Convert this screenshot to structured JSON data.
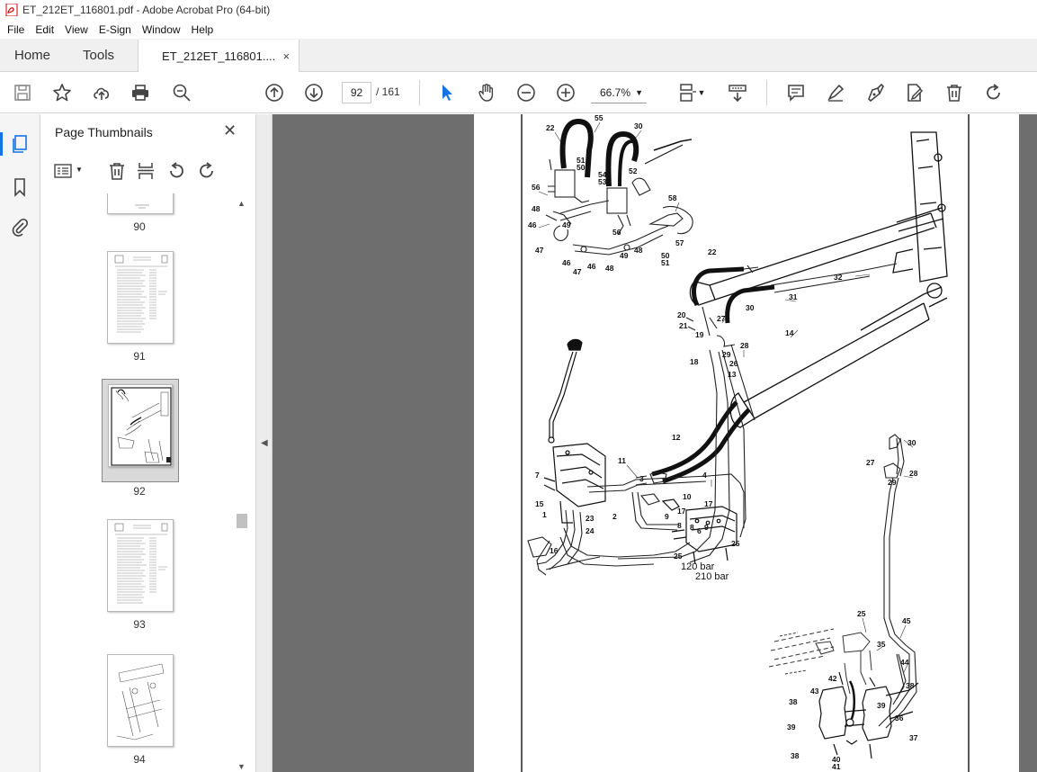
{
  "window": {
    "title": "ET_212ET_116801.pdf - Adobe Acrobat Pro (64-bit)"
  },
  "menu": [
    "File",
    "Edit",
    "View",
    "E-Sign",
    "Window",
    "Help"
  ],
  "tabs": {
    "home": "Home",
    "tools": "Tools",
    "document": "ET_212ET_116801....",
    "close": "×"
  },
  "toolbar": {
    "page_current": "92",
    "page_total": "/  161",
    "zoom": "66.7%"
  },
  "thumbnails_panel": {
    "title": "Page Thumbnails",
    "close": "✕",
    "pages": [
      "90",
      "91",
      "92",
      "93",
      "94"
    ],
    "selected": "92"
  },
  "drawing": {
    "callouts": [
      "22",
      "55",
      "30",
      "51",
      "50",
      "54",
      "53",
      "52",
      "56",
      "48",
      "49",
      "46",
      "58",
      "47",
      "57",
      "56",
      "50",
      "51",
      "46",
      "46",
      "47",
      "48",
      "49",
      "48",
      "22",
      "32",
      "31",
      "30",
      "20",
      "27",
      "21",
      "19",
      "28",
      "29",
      "26",
      "18",
      "14",
      "13",
      "12",
      "11",
      "4",
      "7",
      "3",
      "10",
      "15",
      "17",
      "2",
      "9",
      "1",
      "23",
      "17",
      "9",
      "24",
      "8",
      "8",
      "6",
      "25",
      "16",
      "25",
      "120 bar",
      "210 bar",
      "30",
      "27",
      "28",
      "29",
      "25",
      "45",
      "35",
      "44",
      "42",
      "43",
      "38",
      "38",
      "39",
      "39",
      "40",
      "41",
      "38",
      "36",
      "37"
    ]
  }
}
